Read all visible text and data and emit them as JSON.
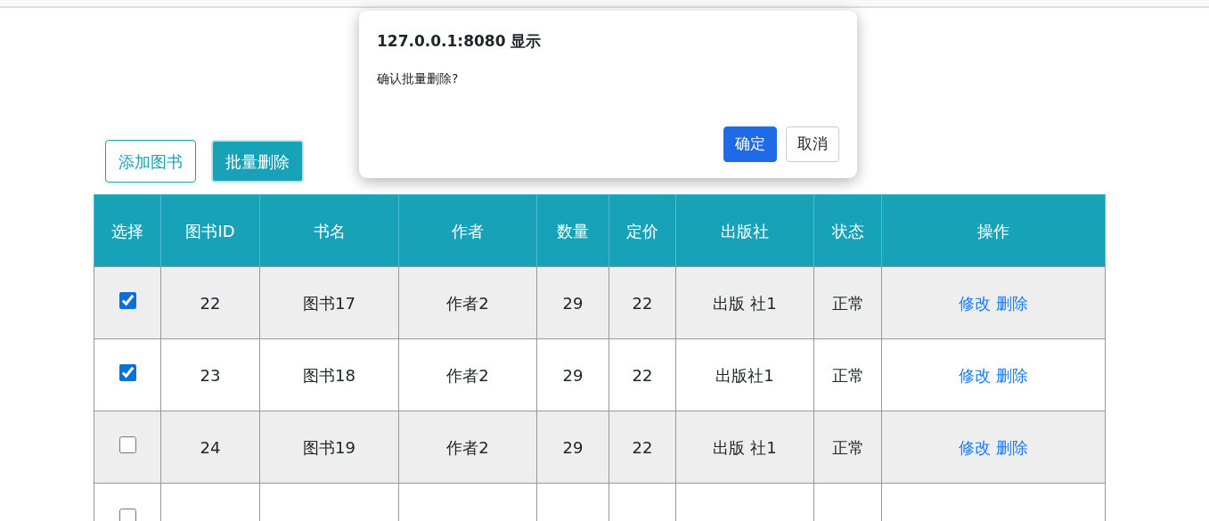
{
  "toolbar": {
    "buttons": [
      {
        "label": "添加图书",
        "kind": "outline"
      },
      {
        "label": "批量删除",
        "kind": "solid"
      }
    ]
  },
  "table": {
    "select_header": "选择",
    "columns": [
      "图书ID",
      "书名",
      "作者",
      "数量",
      "定价",
      "出版社",
      "状态",
      "操作"
    ],
    "rows": [
      {
        "selected": true,
        "cells": [
          "22",
          "图书17",
          "作者2",
          "29",
          "22",
          "出版 社1",
          "正常"
        ],
        "actions": [
          "修改",
          "删除"
        ]
      },
      {
        "selected": true,
        "cells": [
          "23",
          "图书18",
          "作者2",
          "29",
          "22",
          "出版社1",
          "正常"
        ],
        "actions": [
          "修改",
          "删除"
        ]
      },
      {
        "selected": false,
        "cells": [
          "24",
          "图书19",
          "作者2",
          "29",
          "22",
          "出版 社1",
          "正常"
        ],
        "actions": [
          "修改",
          "删除"
        ]
      },
      {
        "selected": false,
        "cells": [],
        "actions": []
      }
    ]
  },
  "dialog": {
    "title": "127.0.0.1:8080 显示",
    "message": "确认批量删除?",
    "buttons": [
      {
        "label": "确定",
        "kind": "primary"
      },
      {
        "label": "取消",
        "kind": "secondary"
      }
    ]
  }
}
